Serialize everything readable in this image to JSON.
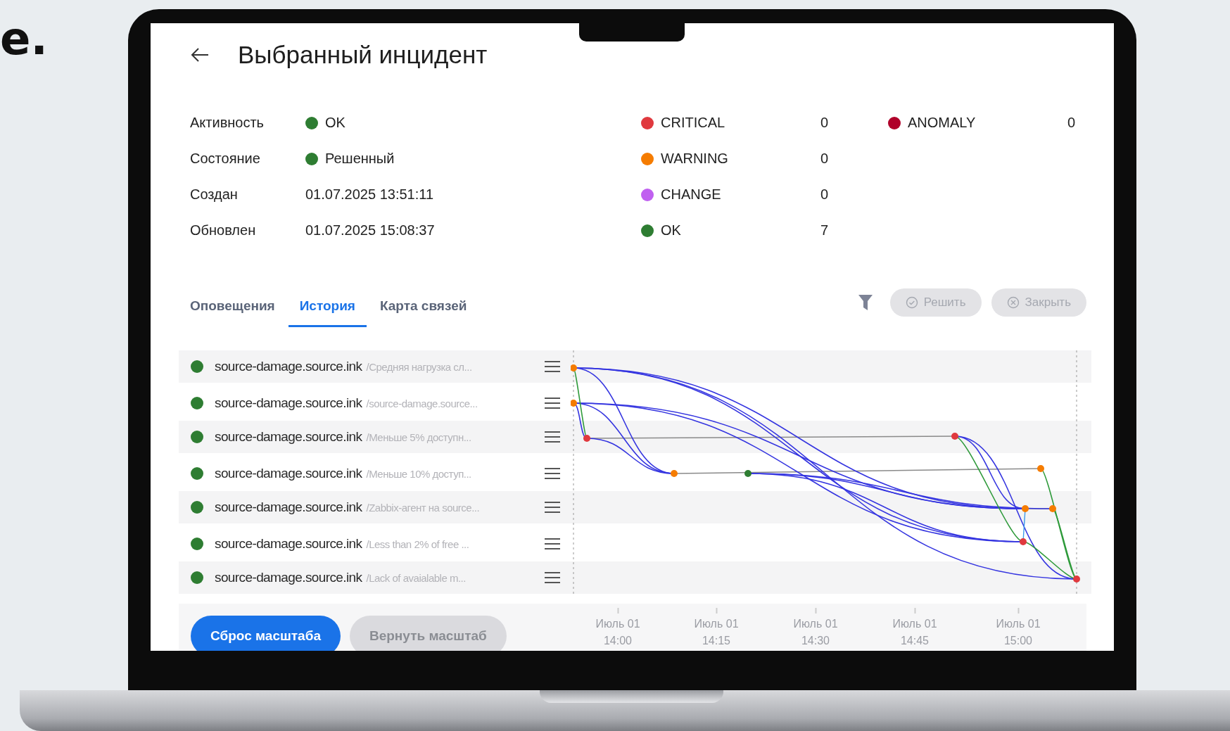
{
  "headline_fragment": "e.",
  "header": {
    "title": "Выбранный инцидент"
  },
  "details": [
    {
      "label": "Активность",
      "value": "OK",
      "color": "#2e7d32"
    },
    {
      "label": "Состояние",
      "value": "Решенный",
      "color": "#2e7d32"
    },
    {
      "label": "Создан",
      "value": "01.07.2025 13:51:11"
    },
    {
      "label": "Обновлен",
      "value": "01.07.2025 15:08:37"
    }
  ],
  "severity_counts": [
    {
      "label": "CRITICAL",
      "count": "0",
      "color": "#e0393e"
    },
    {
      "label": "WARNING",
      "count": "0",
      "color": "#f57c00"
    },
    {
      "label": "CHANGE",
      "count": "0",
      "color": "#c060f0"
    },
    {
      "label": "OK",
      "count": "7",
      "color": "#2e7d32"
    }
  ],
  "anomaly_counts": [
    {
      "label": "ANOMALY",
      "count": "0",
      "color": "#b0002a"
    }
  ],
  "tabs": [
    {
      "label": "Оповещения",
      "selected": false
    },
    {
      "label": "История",
      "selected": true
    },
    {
      "label": "Карта связей",
      "selected": false
    }
  ],
  "actions": [
    {
      "kind": "resolve",
      "label": "Решить",
      "disabled": true
    },
    {
      "kind": "close",
      "label": "Закрыть",
      "disabled": true
    }
  ],
  "events": [
    {
      "host": "source-damage.source.ink",
      "description": "/Средняя нагрузка сл..."
    },
    {
      "host": "source-damage.source.ink",
      "description": "/source-damage.source..."
    },
    {
      "host": "source-damage.source.ink",
      "description": "/Меньше 5% доступн..."
    },
    {
      "host": "source-damage.source.ink",
      "description": "/Меньше 10% доступ..."
    },
    {
      "host": "source-damage.source.ink",
      "description": "/Zabbix-агент на source..."
    },
    {
      "host": "source-damage.source.ink",
      "description": "/Less than 2% of free ..."
    },
    {
      "host": "source-damage.source.ink",
      "description": "/Lack of avaialable m..."
    }
  ],
  "zoom_buttons": [
    {
      "kind": "primary",
      "label": "Сброс масштаба",
      "disabled": false
    },
    {
      "kind": "secondary",
      "label": "Вернуть масштаб",
      "disabled": true
    }
  ],
  "timeline_axis": {
    "ticks": [
      {
        "date": "Июль 01",
        "time": "14:00"
      },
      {
        "date": "Июль 01",
        "time": "14:15"
      },
      {
        "date": "Июль 01",
        "time": "14:30"
      },
      {
        "date": "Июль 01",
        "time": "14:45"
      },
      {
        "date": "Июль 01",
        "time": "15:00"
      }
    ]
  }
}
